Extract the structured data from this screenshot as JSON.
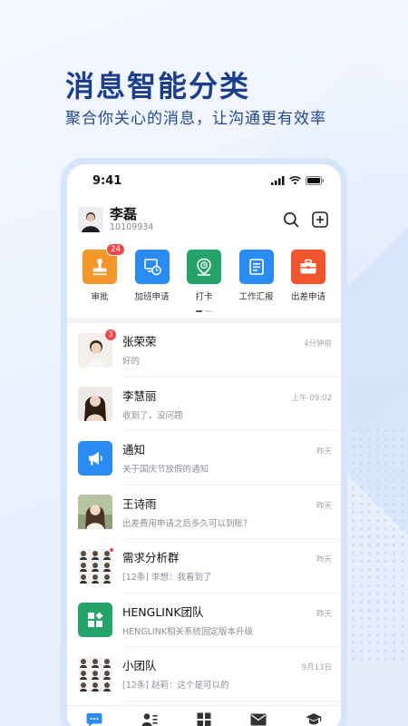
{
  "hero": {
    "title": "消息智能分类",
    "subtitle": "聚合你关心的消息，让沟通更有效率"
  },
  "status_bar": {
    "time": "9:41"
  },
  "profile": {
    "name": "李磊",
    "id": "10109934"
  },
  "apps": [
    {
      "label": "审批",
      "color": "#f5962a",
      "icon": "stamp-icon",
      "badge": "24"
    },
    {
      "label": "加班申请",
      "color": "#2a8cf3",
      "icon": "overtime-icon"
    },
    {
      "label": "打卡",
      "color": "#24a36a",
      "icon": "location-clock-icon"
    },
    {
      "label": "工作汇报",
      "color": "#2a8cf3",
      "icon": "report-icon"
    },
    {
      "label": "出差申请",
      "color": "#f2542d",
      "icon": "briefcase-icon"
    }
  ],
  "conversations": [
    {
      "title": "张荣荣",
      "time": "4分钟前",
      "message": "好的",
      "badge": "3"
    },
    {
      "title": "李慧丽",
      "time": "上午 09:02",
      "message": "收到了，没问题"
    },
    {
      "title": "通知",
      "time": "昨天",
      "message": "关于国庆节放假的通知"
    },
    {
      "title": "王诗雨",
      "time": "昨天",
      "message": "出差费用申请之后多久可以到账？"
    },
    {
      "title": "需求分析群",
      "time": "昨天",
      "message": "[12条] 李想：我看到了"
    },
    {
      "title": "HENGLINK团队",
      "time": "昨天",
      "message": "HENGLINK相关系统固定版本升级"
    },
    {
      "title": "小团队",
      "time": "9月13日",
      "message": "[12条] 赵莉：这个是可以的"
    }
  ],
  "colors": {
    "accent": "#2a8cf3",
    "title": "#1d3e8a",
    "badge": "#f04848"
  }
}
